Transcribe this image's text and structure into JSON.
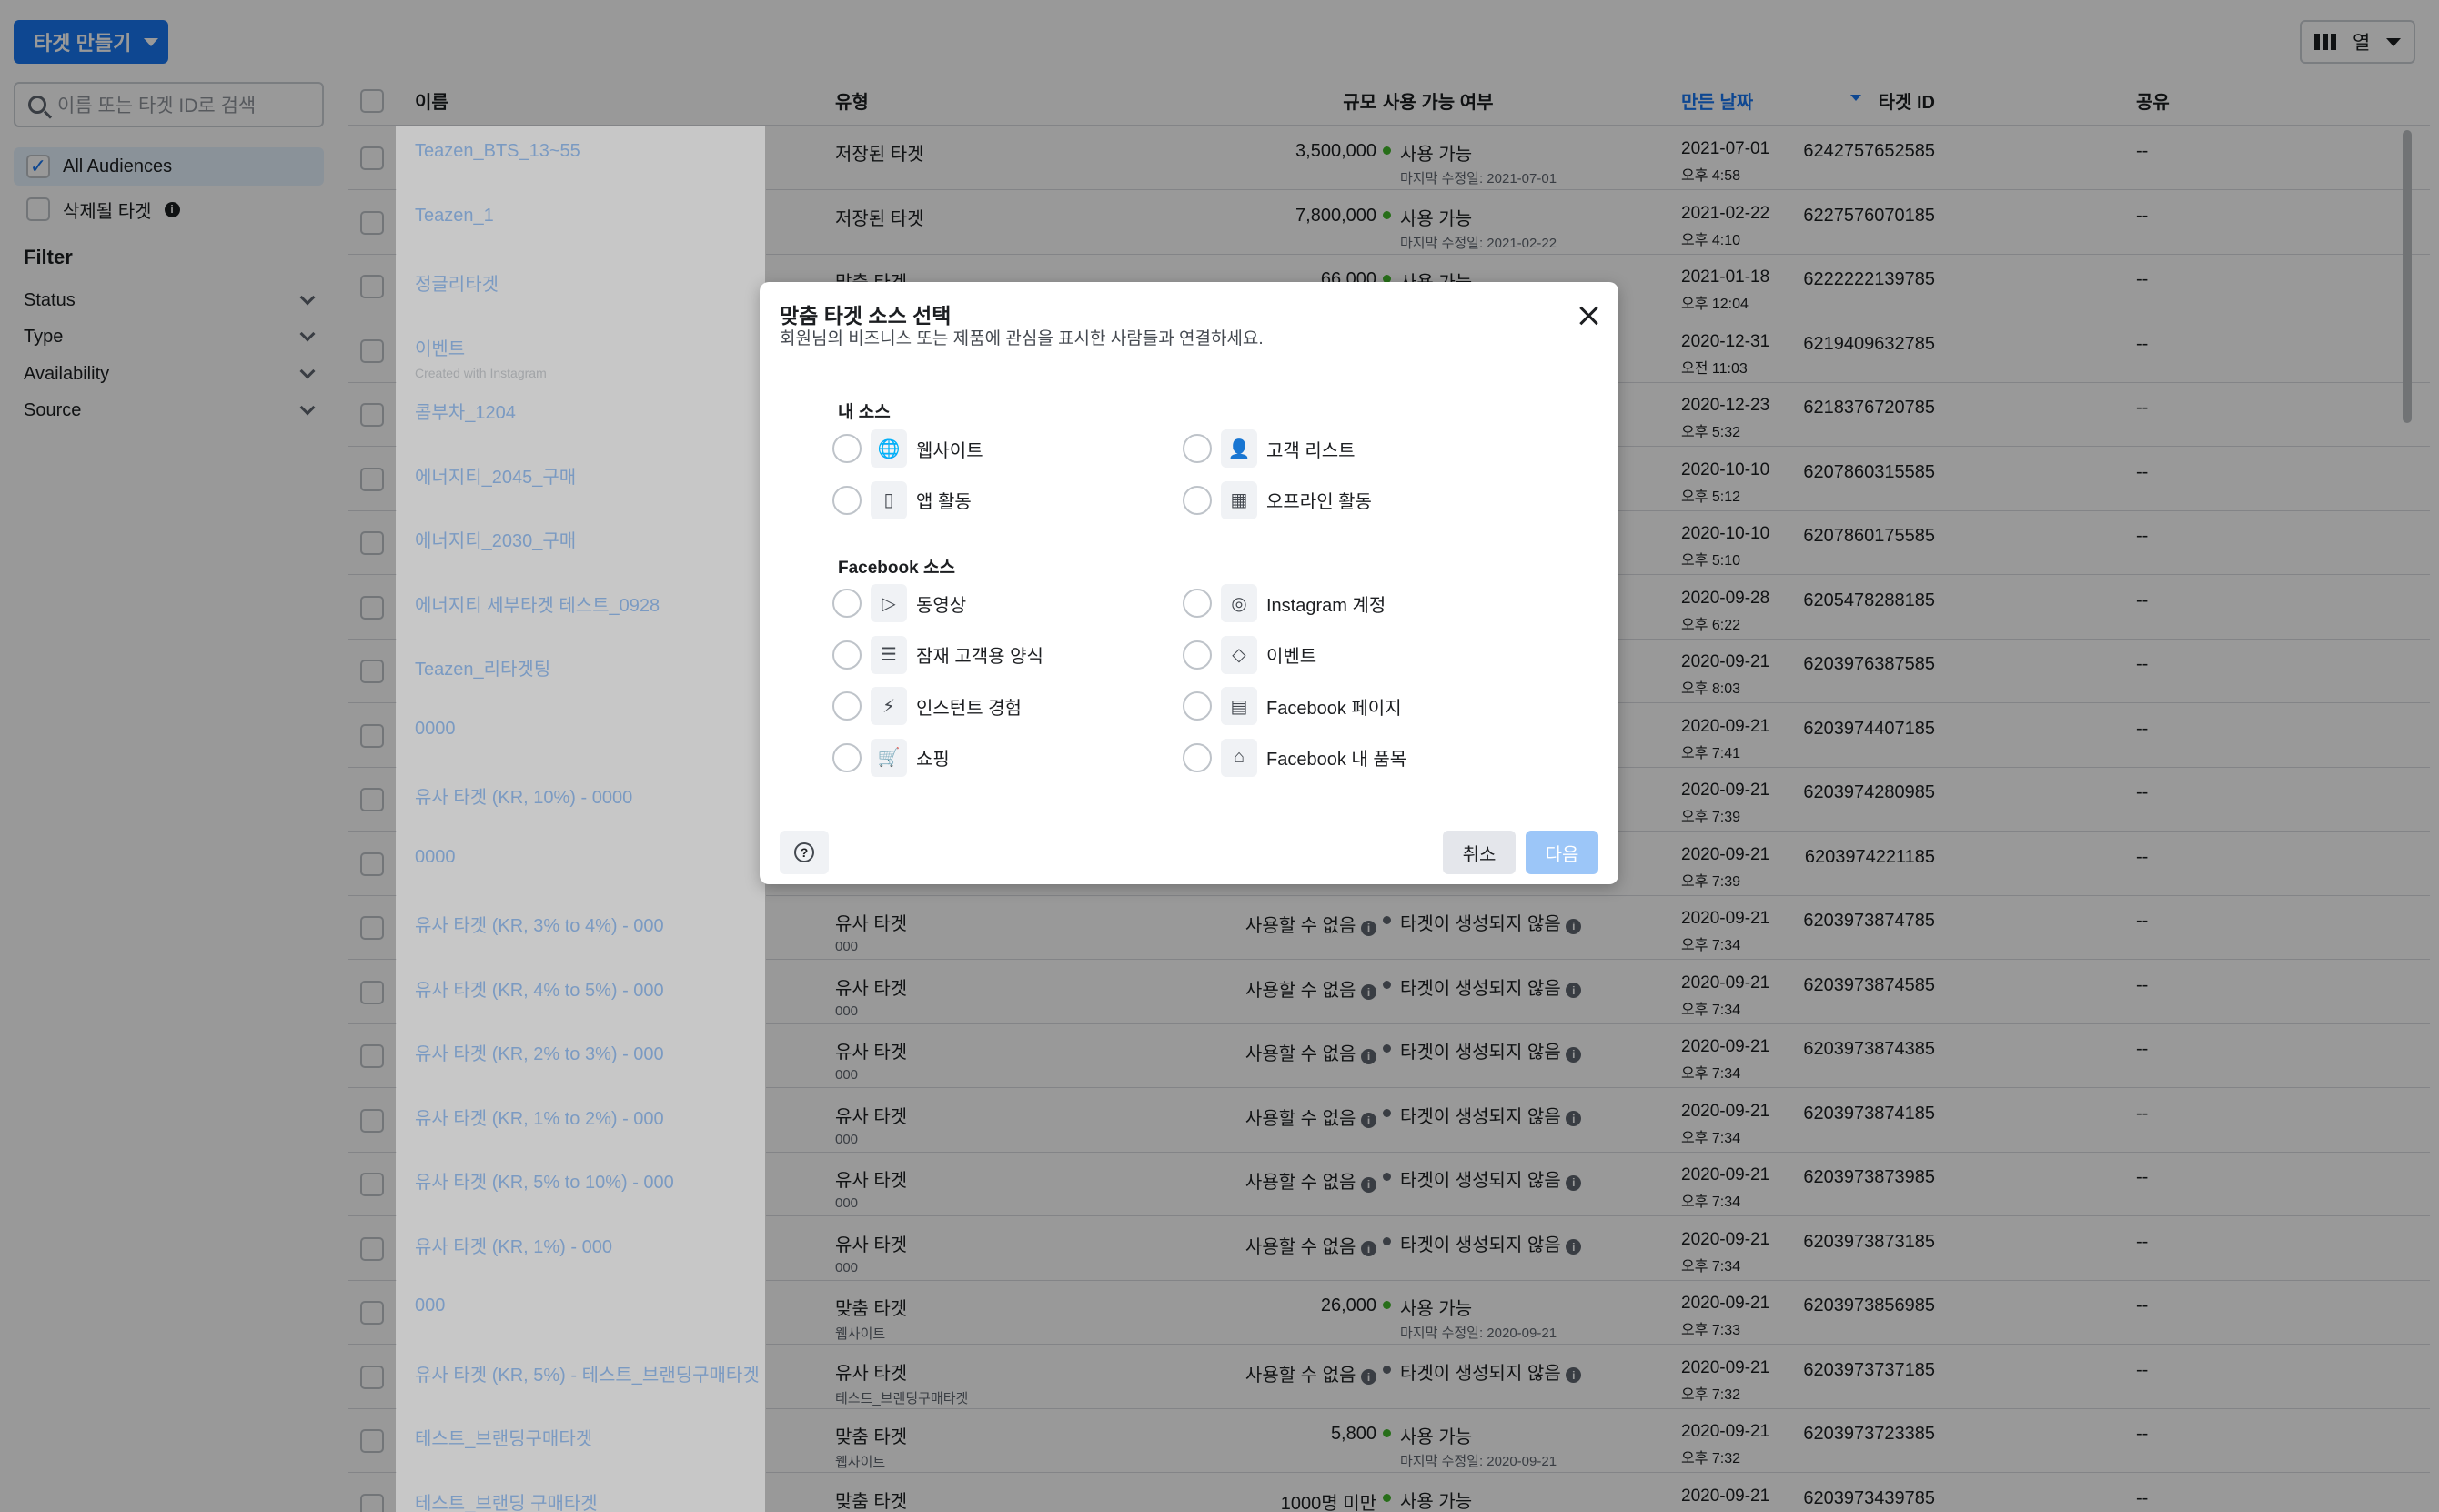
{
  "toolbar": {
    "create_label": "타겟 만들기",
    "columns_label": "열"
  },
  "sidebar": {
    "search_placeholder": "이름 또는 타겟 ID로 검색",
    "all_audiences": "All Audiences",
    "to_be_deleted": "삭제될 타겟",
    "filter_title": "Filter",
    "filters": [
      "Status",
      "Type",
      "Availability",
      "Source"
    ]
  },
  "table": {
    "headers": {
      "name": "이름",
      "type": "유형",
      "size": "규모",
      "availability": "사용 가능 여부",
      "date": "만든 날짜",
      "id": "타겟 ID",
      "share": "공유"
    },
    "rows": [
      {
        "name": "Teazen_BTS_13~55",
        "name_sub": "",
        "type": "저장된 타겟",
        "type_sub": "",
        "size": "3,500,000",
        "avail": "사용 가능",
        "avail_sub": "마지막 수정일: 2021-07-01",
        "date": "2021-07-01",
        "time": "오후 4:58",
        "id": "6242757652585",
        "share": "--"
      },
      {
        "name": "Teazen_1",
        "name_sub": "",
        "type": "저장된 타겟",
        "type_sub": "",
        "size": "7,800,000",
        "avail": "사용 가능",
        "avail_sub": "마지막 수정일: 2021-02-22",
        "date": "2021-02-22",
        "time": "오후 4:10",
        "id": "6227576070185",
        "share": "--"
      },
      {
        "name": "정글리타겟",
        "name_sub": "",
        "type": "맞춤 타겟",
        "type_sub": "",
        "size": "66,000",
        "avail": "사용 가능",
        "avail_sub": "",
        "date": "2021-01-18",
        "time": "오후 12:04",
        "id": "6222222139785",
        "share": "--"
      },
      {
        "name": "이벤트",
        "name_sub": "Created with Instagram",
        "type": "",
        "type_sub": "",
        "size": "",
        "avail": "",
        "avail_sub": "",
        "date": "2020-12-31",
        "time": "오전 11:03",
        "id": "6219409632785",
        "share": "--"
      },
      {
        "name": "콤부차_1204",
        "name_sub": "",
        "type": "",
        "type_sub": "",
        "size": "",
        "avail": "",
        "avail_sub": "",
        "date": "2020-12-23",
        "time": "오후 5:32",
        "id": "6218376720785",
        "share": "--"
      },
      {
        "name": "에너지티_2045_구매",
        "name_sub": "",
        "type": "",
        "type_sub": "",
        "size": "",
        "avail": "",
        "avail_sub": "",
        "date": "2020-10-10",
        "time": "오후 5:12",
        "id": "6207860315585",
        "share": "--"
      },
      {
        "name": "에너지티_2030_구매",
        "name_sub": "",
        "type": "",
        "type_sub": "",
        "size": "",
        "avail": "",
        "avail_sub": "",
        "date": "2020-10-10",
        "time": "오후 5:10",
        "id": "6207860175585",
        "share": "--"
      },
      {
        "name": "에너지티 세부타겟 테스트_0928",
        "name_sub": "",
        "type": "",
        "type_sub": "",
        "size": "",
        "avail": "",
        "avail_sub": "",
        "date": "2020-09-28",
        "time": "오후 6:22",
        "id": "6205478288185",
        "share": "--"
      },
      {
        "name": "Teazen_리타겟팅",
        "name_sub": "",
        "type": "",
        "type_sub": "",
        "size": "",
        "avail": "",
        "avail_sub": "",
        "date": "2020-09-21",
        "time": "오후 8:03",
        "id": "6203976387585",
        "share": "--"
      },
      {
        "name": "0000",
        "name_sub": "",
        "type": "",
        "type_sub": "",
        "size": "",
        "avail": "",
        "avail_sub": "",
        "date": "2020-09-21",
        "time": "오후 7:41",
        "id": "6203974407185",
        "share": "--"
      },
      {
        "name": "유사 타겟 (KR, 10%) - 0000",
        "name_sub": "",
        "type": "",
        "type_sub": "",
        "size": "",
        "avail": "",
        "avail_sub": "",
        "date": "2020-09-21",
        "time": "오후 7:39",
        "id": "6203974280985",
        "share": "--"
      },
      {
        "name": "0000",
        "name_sub": "",
        "type": "",
        "type_sub": "",
        "size": "",
        "avail": "",
        "avail_sub": "",
        "date": "2020-09-21",
        "time": "오후 7:39",
        "id": "6203974221185",
        "share": "--"
      },
      {
        "name": "유사 타겟 (KR, 3% to 4%) - 000",
        "name_sub": "",
        "type": "유사 타겟",
        "type_sub": "000",
        "size": "사용할 수 없음",
        "avail": "타겟이 생성되지 않음",
        "avail_sub": "",
        "date": "2020-09-21",
        "time": "오후 7:34",
        "id": "6203973874785",
        "share": "--"
      },
      {
        "name": "유사 타겟 (KR, 4% to 5%) - 000",
        "name_sub": "",
        "type": "유사 타겟",
        "type_sub": "000",
        "size": "사용할 수 없음",
        "avail": "타겟이 생성되지 않음",
        "avail_sub": "",
        "date": "2020-09-21",
        "time": "오후 7:34",
        "id": "6203973874585",
        "share": "--"
      },
      {
        "name": "유사 타겟 (KR, 2% to 3%) - 000",
        "name_sub": "",
        "type": "유사 타겟",
        "type_sub": "000",
        "size": "사용할 수 없음",
        "avail": "타겟이 생성되지 않음",
        "avail_sub": "",
        "date": "2020-09-21",
        "time": "오후 7:34",
        "id": "6203973874385",
        "share": "--"
      },
      {
        "name": "유사 타겟 (KR, 1% to 2%) - 000",
        "name_sub": "",
        "type": "유사 타겟",
        "type_sub": "000",
        "size": "사용할 수 없음",
        "avail": "타겟이 생성되지 않음",
        "avail_sub": "",
        "date": "2020-09-21",
        "time": "오후 7:34",
        "id": "6203973874185",
        "share": "--"
      },
      {
        "name": "유사 타겟 (KR, 5% to 10%) - 000",
        "name_sub": "",
        "type": "유사 타겟",
        "type_sub": "000",
        "size": "사용할 수 없음",
        "avail": "타겟이 생성되지 않음",
        "avail_sub": "",
        "date": "2020-09-21",
        "time": "오후 7:34",
        "id": "6203973873985",
        "share": "--"
      },
      {
        "name": "유사 타겟 (KR, 1%) - 000",
        "name_sub": "",
        "type": "유사 타겟",
        "type_sub": "000",
        "size": "사용할 수 없음",
        "avail": "타겟이 생성되지 않음",
        "avail_sub": "",
        "date": "2020-09-21",
        "time": "오후 7:34",
        "id": "6203973873185",
        "share": "--"
      },
      {
        "name": "000",
        "name_sub": "",
        "type": "맞춤 타겟",
        "type_sub": "웹사이트",
        "size": "26,000",
        "avail": "사용 가능",
        "avail_sub": "마지막 수정일: 2020-09-21",
        "date": "2020-09-21",
        "time": "오후 7:33",
        "id": "6203973856985",
        "share": "--"
      },
      {
        "name": "유사 타겟 (KR, 5%) - 테스트_브랜딩구매타겟",
        "name_sub": "",
        "type": "유사 타겟",
        "type_sub": "테스트_브랜딩구매타겟",
        "size": "사용할 수 없음",
        "avail": "타겟이 생성되지 않음",
        "avail_sub": "",
        "date": "2020-09-21",
        "time": "오후 7:32",
        "id": "6203973737185",
        "share": "--"
      },
      {
        "name": "테스트_브랜딩구매타겟",
        "name_sub": "",
        "type": "맞춤 타겟",
        "type_sub": "웹사이트",
        "size": "5,800",
        "avail": "사용 가능",
        "avail_sub": "마지막 수정일: 2020-09-21",
        "date": "2020-09-21",
        "time": "오후 7:32",
        "id": "6203973723385",
        "share": "--"
      },
      {
        "name": "테스트_브랜딩 구매타겟",
        "name_sub": "",
        "type": "맞춤 타겟",
        "type_sub": "",
        "size": "1000명 미만",
        "avail": "사용 가능",
        "avail_sub": "",
        "date": "2020-09-21",
        "time": "",
        "id": "6203973439785",
        "share": "--"
      }
    ]
  },
  "modal": {
    "title": "맞춤 타겟 소스 선택",
    "subtitle": "회원님의 비즈니스 또는 제품에 관심을 표시한 사람들과 연결하세요.",
    "my_sources_title": "내 소스",
    "my_sources": [
      {
        "label": "웹사이트",
        "icon": "globe-icon"
      },
      {
        "label": "고객 리스트",
        "icon": "customer-list-icon"
      },
      {
        "label": "앱 활동",
        "icon": "mobile-app-icon"
      },
      {
        "label": "오프라인 활동",
        "icon": "store-icon"
      }
    ],
    "fb_sources_title": "Facebook 소스",
    "fb_sources": [
      {
        "label": "동영상",
        "icon": "video-play-icon"
      },
      {
        "label": "Instagram 계정",
        "icon": "instagram-icon"
      },
      {
        "label": "잠재 고객용 양식",
        "icon": "form-lines-icon"
      },
      {
        "label": "이벤트",
        "icon": "ticket-icon"
      },
      {
        "label": "인스턴트 경험",
        "icon": "lightning-icon"
      },
      {
        "label": "Facebook 페이지",
        "icon": "page-icon"
      },
      {
        "label": "쇼핑",
        "icon": "cart-icon"
      },
      {
        "label": "Facebook 내 품목",
        "icon": "shop-icon"
      }
    ],
    "cancel_label": "취소",
    "next_label": "다음"
  },
  "colors": {
    "accent": "#1877f2",
    "available": "#42b72a",
    "unavailable": "#606770"
  }
}
